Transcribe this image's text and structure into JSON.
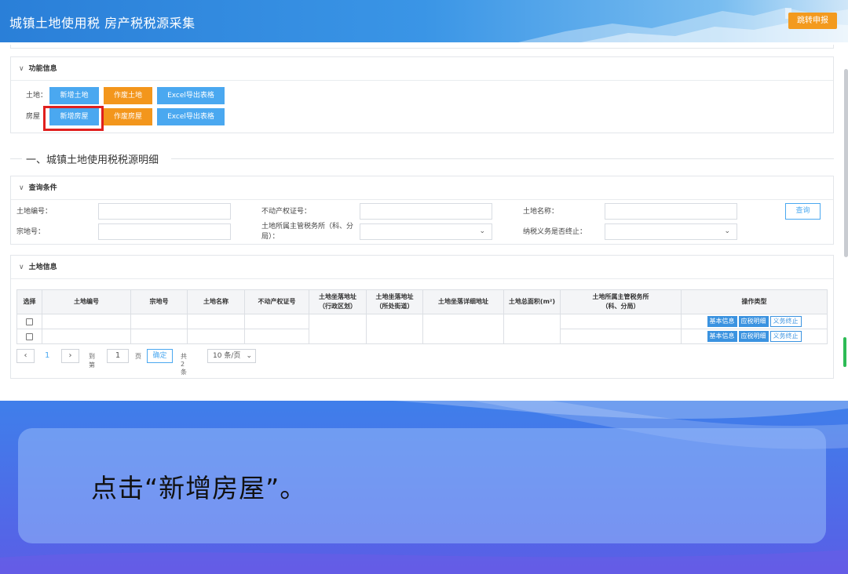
{
  "header": {
    "title": "城镇土地使用税 房产税税源采集",
    "jump_label": "跳转申报"
  },
  "function_panel": {
    "title": "功能信息",
    "land_label": "土地：",
    "house_label": "房屋",
    "land_buttons": [
      "新增土地",
      "作废土地",
      "Excel导出表格"
    ],
    "house_buttons": [
      "新增房屋",
      "作废房屋",
      "Excel导出表格"
    ]
  },
  "section": {
    "title": "一、城镇土地使用税税源明细"
  },
  "query_panel": {
    "title": "查询条件",
    "land_no_label": "土地编号：",
    "parcel_no_label": "宗地号：",
    "property_cert_label": "不动产权证号：",
    "tax_office_label": "土地所属主管税务所（科、分局）：",
    "land_name_label": "土地名称：",
    "obligation_end_label": "纳税义务是否终止：",
    "query_button": "查询"
  },
  "land_panel": {
    "title": "土地信息",
    "columns": [
      "选择",
      "土地编号",
      "宗地号",
      "土地名称",
      "不动产权证号",
      "土地坐落地址（行政区划）",
      "土地坐落地址（所处街道）",
      "土地坐落详细地址",
      "土地总面积(m²)",
      "土地所属主管税务所（科、分局）",
      "操作类型"
    ],
    "col_loc1_a": "土地坐落地址",
    "col_loc1_b": "（行政区划）",
    "col_loc2_a": "土地坐落地址",
    "col_loc2_b": "（所处街道）",
    "col_office_a": "土地所属主管税务所",
    "col_office_b": "（科、分局）",
    "row_ops": [
      "基本信息",
      "应税明细",
      "义务终止"
    ]
  },
  "pager": {
    "current_page": "1",
    "goto_label": "到第",
    "goto_value": "1",
    "page_unit": "页",
    "confirm_label": "确定",
    "total_label": "共 2 条",
    "page_size": "10 条/页"
  },
  "caption": {
    "text": "点击“新增房屋”。"
  },
  "colors": {
    "primary": "#4aa8f0",
    "orange": "#f3961c",
    "highlight": "#e0201e",
    "bottom_bg": "#4d6de8"
  }
}
